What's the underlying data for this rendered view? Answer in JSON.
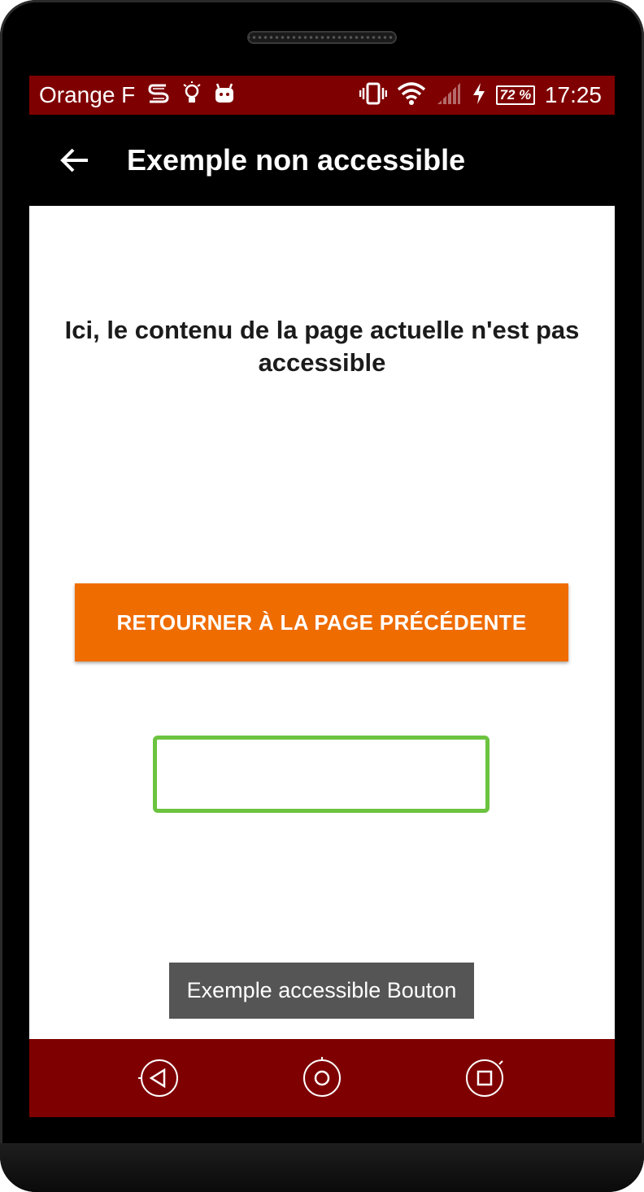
{
  "status_bar": {
    "carrier": "Orange F",
    "battery": "72 %",
    "time": "17:25",
    "icons": [
      "s-icon",
      "lightbulb-icon",
      "android-icon",
      "vibrate-icon",
      "wifi-icon",
      "signal-icon",
      "charging-icon",
      "battery-icon"
    ],
    "color": "#7f0000"
  },
  "app_bar": {
    "title": "Exemple non accessible",
    "back_icon": "arrow-left-icon"
  },
  "content": {
    "message": "Ici, le contenu de la page actuelle n'est pas accessible",
    "back_button_label": "RETOURNER À LA PAGE PRÉCÉDENTE",
    "button_color": "#ef6c00",
    "focus_box_color": "#6cc33f"
  },
  "toast": {
    "text": "Exemple accessible Bouton"
  },
  "nav_bar": {
    "buttons": [
      "back-icon",
      "home-icon",
      "recents-icon"
    ],
    "color": "#7f0000"
  }
}
